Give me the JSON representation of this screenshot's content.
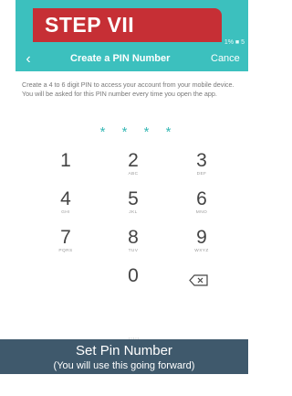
{
  "status_bar": {
    "text": "1% ■ 5"
  },
  "nav": {
    "back_icon": "chevron-left-icon",
    "title": "Create a PIN Number",
    "cancel": "Cance"
  },
  "instructions": "Create a 4 to 6 digit PIN to access your account from your mobile device. You will be asked for this PIN number every time you open the app.",
  "pin_dots": "* * * *",
  "keypad": {
    "rows": [
      [
        {
          "digit": "1",
          "letters": ""
        },
        {
          "digit": "2",
          "letters": "ABC"
        },
        {
          "digit": "3",
          "letters": "DEF"
        }
      ],
      [
        {
          "digit": "4",
          "letters": "GHI"
        },
        {
          "digit": "5",
          "letters": "JKL"
        },
        {
          "digit": "6",
          "letters": "MNO"
        }
      ],
      [
        {
          "digit": "7",
          "letters": "PQRS"
        },
        {
          "digit": "8",
          "letters": "TUV"
        },
        {
          "digit": "9",
          "letters": "WXYZ"
        }
      ]
    ],
    "zero": "0",
    "backspace_icon": "backspace-icon"
  },
  "pager_dots": "•••••",
  "step_label": "STEP VII",
  "caption": {
    "title": "Set Pin Number",
    "subtitle": "(You will use this going forward)"
  },
  "colors": {
    "accent": "#3cc0be",
    "step_red": "#c62f35",
    "caption_bg": "#3f596c"
  }
}
